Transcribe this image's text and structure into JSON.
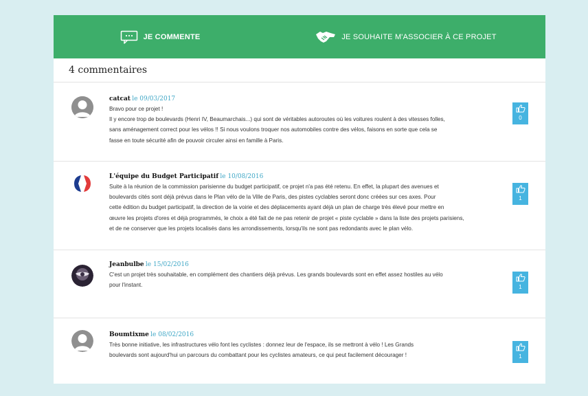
{
  "topbar": {
    "comment_label": "JE COMMENTE",
    "associate_label": "JE SOUHAITE M'ASSOCIER À CE PROJET"
  },
  "comments_count_label": "4 commentaires",
  "colors": {
    "accent_green": "#3dae6a",
    "like_blue": "#46b4e0",
    "date_blue": "#3fa7c6",
    "background": "#d9eef1"
  },
  "comments": [
    {
      "author": "catcat",
      "date": "le 09/03/2017",
      "avatar_icon": "default-user-avatar",
      "lines": [
        "Bravo pour ce projet !",
        "Il y encore trop de boulevards (Henri IV, Beaumarchais...) qui sont de véritables autoroutes où les voitures roulent à des vitesses folles,",
        "sans aménagement correct pour les vélos !! Si nous voulons troquer nos automobiles contre des vélos, faisons en sorte que cela se",
        "fasse en toute sécurité afin de pouvoir circuler ainsi en famille à Paris."
      ],
      "likes": "0"
    },
    {
      "author": "L'équipe du Budget Participatif",
      "date": "le 10/08/2016",
      "avatar_icon": "paris-logo-avatar",
      "lines": [
        "Suite à la réunion de la commission parisienne du budget participatif, ce projet n'a pas été retenu. En effet, la plupart des avenues et",
        "boulevards cités sont déjà prévus dans le Plan vélo de la Ville de Paris, des pistes cyclables seront donc créées sur ces axes. Pour",
        "cette édition du budget participatif, la direction de la voirie et des déplacements ayant déjà un plan de charge très élevé pour mettre en",
        "œuvre les projets d'ores et déjà programmés, le choix a été fait de ne pas retenir de projet « piste cyclable » dans la liste des projets parisiens,",
        "et de ne conserver que les projets localisés dans les arrondissements, lorsqu'ils ne sont pas redondants avec le plan vélo."
      ],
      "likes": "1"
    },
    {
      "author": "Jeanbulbe",
      "date": "le 15/02/2016",
      "avatar_icon": "user-photo-avatar",
      "lines": [
        "C'est un projet très souhaitable, en complément des chantiers déjà prévus. Les grands boulevards sont en effet assez hostiles au vélo",
        "pour l'instant."
      ],
      "likes": "1"
    },
    {
      "author": "Boumtixme",
      "date": "le 08/02/2016",
      "avatar_icon": "default-user-avatar",
      "lines": [
        "Très bonne initiative, les infrastructures vélo font les cyclistes : donnez leur de l'espace, ils se mettront à vélo ! Les Grands",
        "boulevards sont aujourd'hui un parcours du combattant pour les cyclistes amateurs, ce qui peut facilement décourager !"
      ],
      "likes": "1"
    }
  ]
}
